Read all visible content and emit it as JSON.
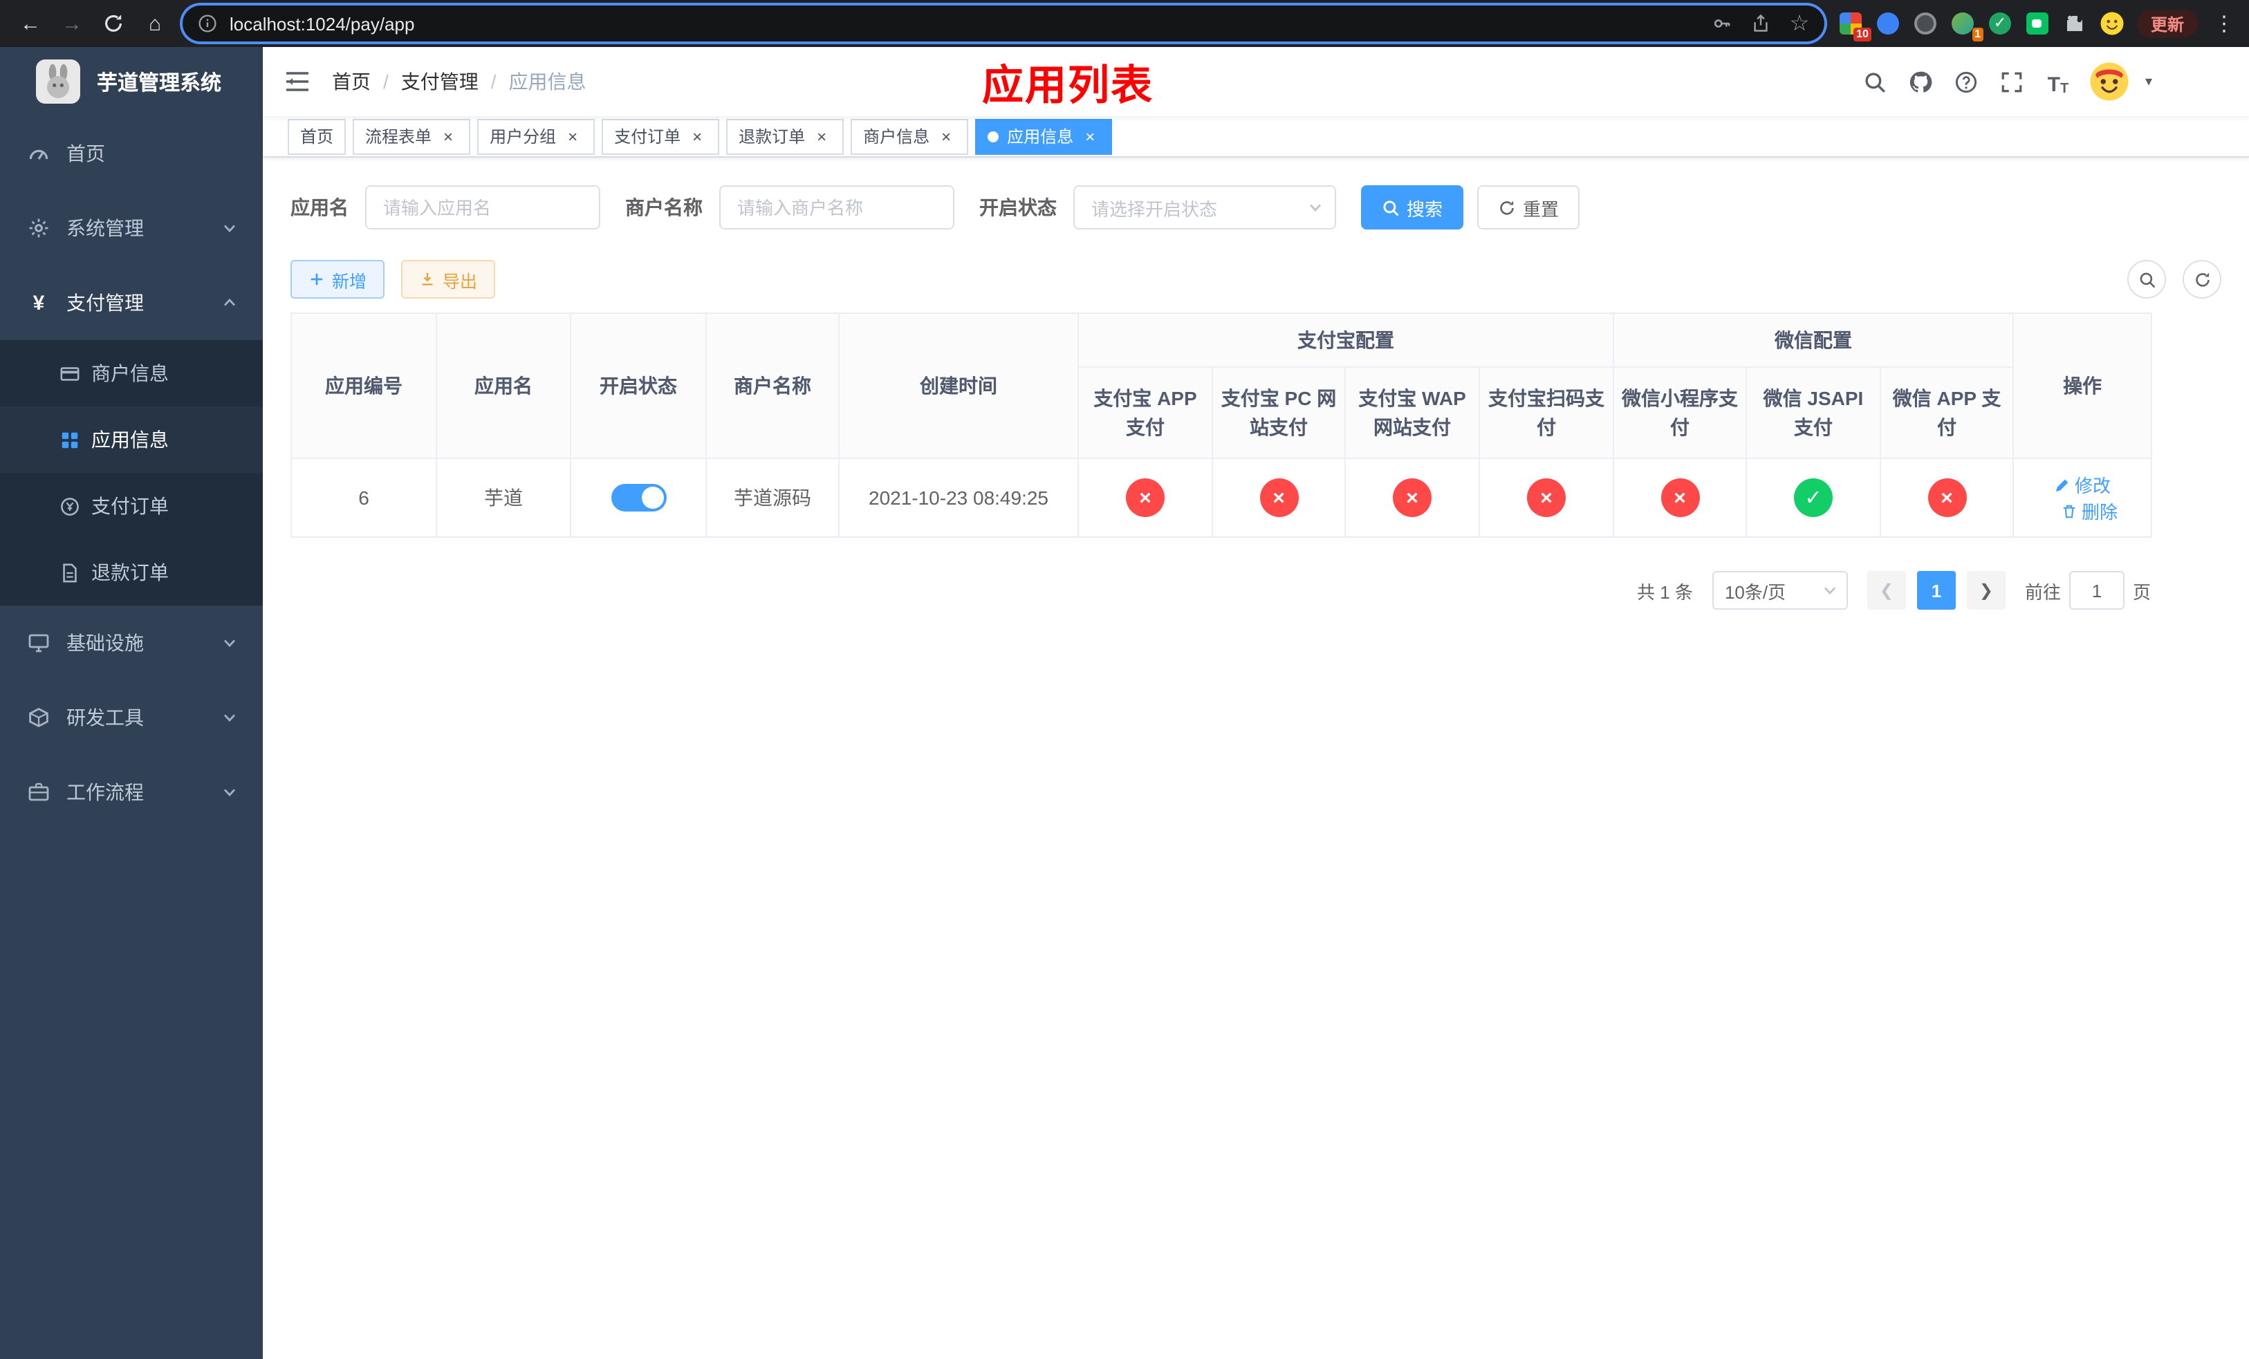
{
  "colors": {
    "primary": "#409eff",
    "danger": "#ff4949",
    "success": "#13ce66",
    "warning": "#e6a23c",
    "sidebar_bg": "#304156",
    "submenu_bg": "#1f2d3d",
    "title_red": "#ff0000"
  },
  "browser": {
    "url": "localhost:1024/pay/app",
    "update_label": "更新",
    "ext_badge_1": "10",
    "ext_badge_2": "1"
  },
  "sidebar": {
    "title": "芋道管理系统",
    "items": [
      {
        "label": "首页"
      },
      {
        "label": "系统管理"
      },
      {
        "label": "支付管理",
        "children": [
          {
            "label": "商户信息"
          },
          {
            "label": "应用信息"
          },
          {
            "label": "支付订单"
          },
          {
            "label": "退款订单"
          }
        ]
      },
      {
        "label": "基础设施"
      },
      {
        "label": "研发工具"
      },
      {
        "label": "工作流程"
      }
    ]
  },
  "navbar": {
    "breadcrumb": [
      "首页",
      "支付管理",
      "应用信息"
    ],
    "page_title": "应用列表"
  },
  "tabs": [
    {
      "label": "首页"
    },
    {
      "label": "流程表单"
    },
    {
      "label": "用户分组"
    },
    {
      "label": "支付订单"
    },
    {
      "label": "退款订单"
    },
    {
      "label": "商户信息"
    },
    {
      "label": "应用信息"
    }
  ],
  "filters": {
    "app_name_label": "应用名",
    "app_name_placeholder": "请输入应用名",
    "merchant_label": "商户名称",
    "merchant_placeholder": "请输入商户名称",
    "status_label": "开启状态",
    "status_placeholder": "请选择开启状态",
    "search_label": "搜索",
    "reset_label": "重置"
  },
  "toolbar": {
    "add_label": "新增",
    "export_label": "导出"
  },
  "table": {
    "header": {
      "app_id": "应用编号",
      "app_name": "应用名",
      "status": "开启状态",
      "merchant": "商户名称",
      "created": "创建时间",
      "alipay_group": "支付宝配置",
      "alipay_cols": [
        "支付宝 APP 支付",
        "支付宝 PC 网站支付",
        "支付宝 WAP 网站支付",
        "支付宝扫码支付"
      ],
      "wechat_group": "微信配置",
      "wechat_cols": [
        "微信小程序支付",
        "微信 JSAPI 支付",
        "微信 APP 支付"
      ],
      "actions": "操作"
    },
    "rows": [
      {
        "app_id": "6",
        "app_name": "芋道",
        "enabled": true,
        "merchant": "芋道源码",
        "created": "2021-10-23 08:49:25",
        "statuses": [
          "fail",
          "fail",
          "fail",
          "fail",
          "fail",
          "success",
          "fail"
        ],
        "edit_label": "修改",
        "delete_label": "删除"
      }
    ]
  },
  "pagination": {
    "total": "共 1 条",
    "page_size": "10条/页",
    "current_page": "1",
    "goto_label": "前往",
    "goto_value": "1",
    "page_unit": "页"
  }
}
